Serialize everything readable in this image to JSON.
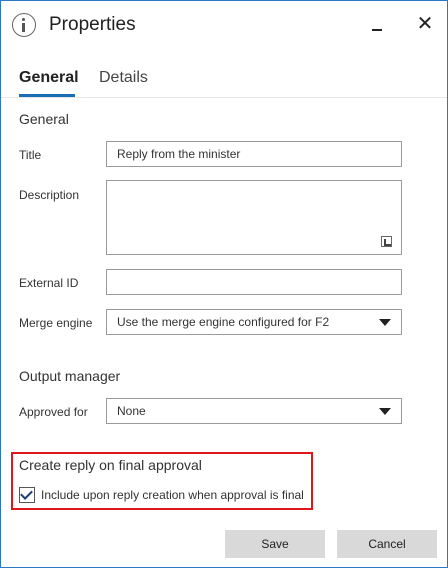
{
  "window": {
    "title": "Properties"
  },
  "tabs": [
    {
      "label": "General",
      "active": true
    },
    {
      "label": "Details",
      "active": false
    }
  ],
  "general_section": {
    "heading": "General",
    "title_label": "Title",
    "title_value": "Reply from the minister",
    "description_label": "Description",
    "description_value": "",
    "external_id_label": "External ID",
    "external_id_value": "",
    "merge_engine_label": "Merge engine",
    "merge_engine_value": "Use the merge engine configured for F2"
  },
  "output_section": {
    "heading": "Output manager",
    "approved_for_label": "Approved for",
    "approved_for_value": "None"
  },
  "reply_section": {
    "heading": "Create reply on final approval",
    "checkbox_label": "Include upon reply creation when approval is final",
    "checkbox_checked": true
  },
  "buttons": {
    "save": "Save",
    "cancel": "Cancel"
  },
  "colors": {
    "accent": "#1a6cb5",
    "highlight": "#e0161b",
    "button_bg": "#d9d9d9"
  },
  "icons": {
    "header": "info-icon",
    "minimize": "minimize-icon",
    "close": "close-icon",
    "resize": "expand-icon",
    "dropdown": "chevron-down-icon",
    "check": "checkmark-icon"
  }
}
